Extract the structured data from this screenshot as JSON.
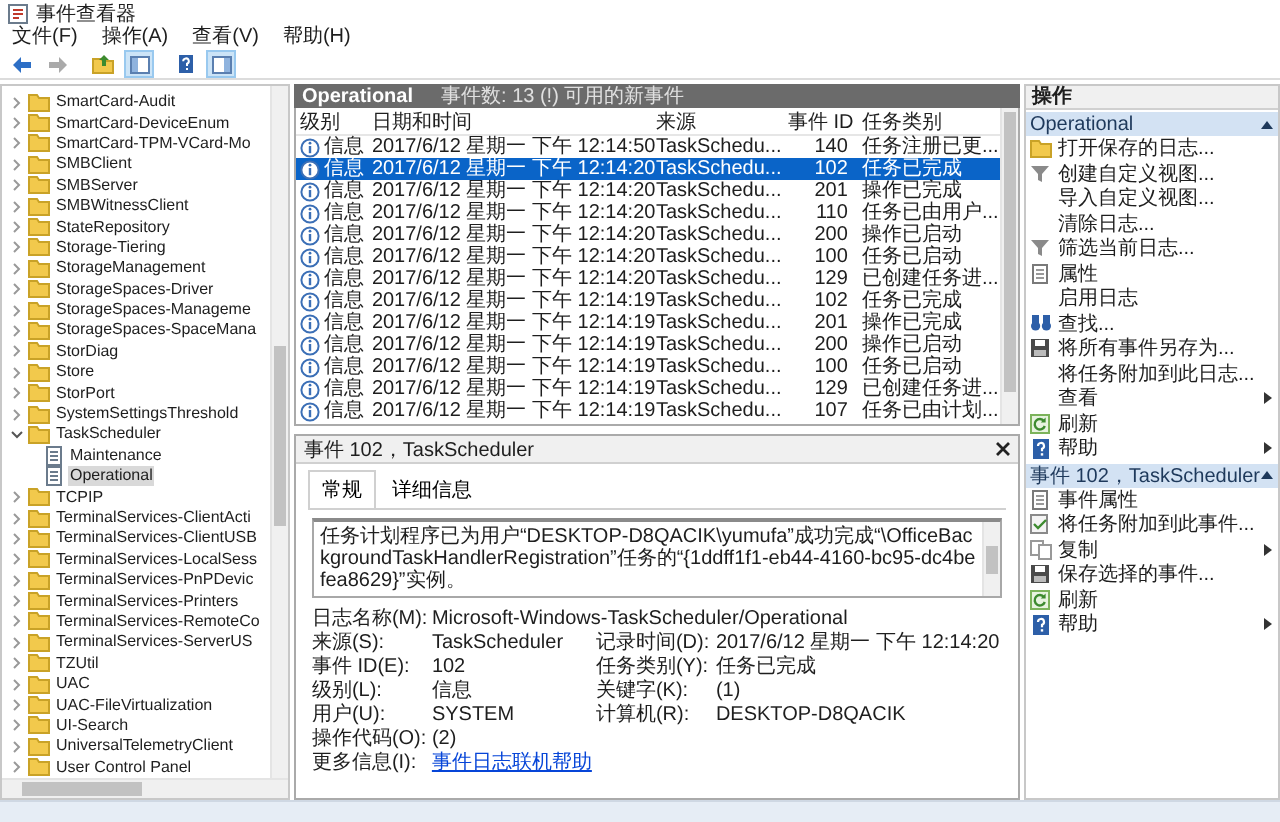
{
  "window": {
    "title": "事件查看器"
  },
  "menu": [
    "文件(F)",
    "操作(A)",
    "查看(V)",
    "帮助(H)"
  ],
  "toolbar": [
    {
      "kind": "back",
      "disabled": false,
      "pressed": false
    },
    {
      "kind": "forward",
      "disabled": true,
      "pressed": false
    },
    {
      "kind": "up",
      "pressed": false
    },
    {
      "kind": "tree",
      "pressed": true
    },
    {
      "kind": "help",
      "pressed": false
    },
    {
      "kind": "pane",
      "pressed": true
    }
  ],
  "tree": {
    "items": [
      {
        "label": "SmartCard-Audit",
        "kind": "folder",
        "expanded": false,
        "selected": false
      },
      {
        "label": "SmartCard-DeviceEnum",
        "kind": "folder",
        "expanded": false,
        "selected": false
      },
      {
        "label": "SmartCard-TPM-VCard-Mo",
        "kind": "folder",
        "expanded": false,
        "selected": false
      },
      {
        "label": "SMBClient",
        "kind": "folder",
        "expanded": false,
        "selected": false
      },
      {
        "label": "SMBServer",
        "kind": "folder",
        "expanded": false,
        "selected": false
      },
      {
        "label": "SMBWitnessClient",
        "kind": "folder",
        "expanded": false,
        "selected": false
      },
      {
        "label": "StateRepository",
        "kind": "folder",
        "expanded": false,
        "selected": false
      },
      {
        "label": "Storage-Tiering",
        "kind": "folder",
        "expanded": false,
        "selected": false
      },
      {
        "label": "StorageManagement",
        "kind": "folder",
        "expanded": false,
        "selected": false
      },
      {
        "label": "StorageSpaces-Driver",
        "kind": "folder",
        "expanded": false,
        "selected": false
      },
      {
        "label": "StorageSpaces-Manageme",
        "kind": "folder",
        "expanded": false,
        "selected": false
      },
      {
        "label": "StorageSpaces-SpaceMana",
        "kind": "folder",
        "expanded": false,
        "selected": false
      },
      {
        "label": "StorDiag",
        "kind": "folder",
        "expanded": false,
        "selected": false
      },
      {
        "label": "Store",
        "kind": "folder",
        "expanded": false,
        "selected": false
      },
      {
        "label": "StorPort",
        "kind": "folder",
        "expanded": false,
        "selected": false
      },
      {
        "label": "SystemSettingsThreshold",
        "kind": "folder",
        "expanded": false,
        "selected": false
      },
      {
        "label": "TaskScheduler",
        "kind": "folder",
        "expanded": true,
        "selected": false,
        "children": [
          {
            "label": "Maintenance",
            "kind": "log",
            "selected": false
          },
          {
            "label": "Operational",
            "kind": "log",
            "selected": true
          }
        ]
      },
      {
        "label": "TCPIP",
        "kind": "folder",
        "expanded": false,
        "selected": false
      },
      {
        "label": "TerminalServices-ClientActi",
        "kind": "folder",
        "expanded": false,
        "selected": false
      },
      {
        "label": "TerminalServices-ClientUSB",
        "kind": "folder",
        "expanded": false,
        "selected": false
      },
      {
        "label": "TerminalServices-LocalSess",
        "kind": "folder",
        "expanded": false,
        "selected": false
      },
      {
        "label": "TerminalServices-PnPDevic",
        "kind": "folder",
        "expanded": false,
        "selected": false
      },
      {
        "label": "TerminalServices-Printers",
        "kind": "folder",
        "expanded": false,
        "selected": false
      },
      {
        "label": "TerminalServices-RemoteCo",
        "kind": "folder",
        "expanded": false,
        "selected": false
      },
      {
        "label": "TerminalServices-ServerUS",
        "kind": "folder",
        "expanded": false,
        "selected": false
      },
      {
        "label": "TZUtil",
        "kind": "folder",
        "expanded": false,
        "selected": false
      },
      {
        "label": "UAC",
        "kind": "folder",
        "expanded": false,
        "selected": false
      },
      {
        "label": "UAC-FileVirtualization",
        "kind": "folder",
        "expanded": false,
        "selected": false
      },
      {
        "label": "UI-Search",
        "kind": "folder",
        "expanded": false,
        "selected": false
      },
      {
        "label": "UniversalTelemetryClient",
        "kind": "folder",
        "expanded": false,
        "selected": false
      },
      {
        "label": "User Control Panel",
        "kind": "folder",
        "expanded": false,
        "selected": false
      }
    ]
  },
  "log_header": {
    "title": "Operational",
    "summary": "事件数: 13 (!) 可用的新事件"
  },
  "table": {
    "columns": [
      "级别",
      "日期和时间",
      "来源",
      "事件 ID",
      "任务类别"
    ],
    "rows": [
      {
        "kind": "info",
        "level": "信息",
        "date": "2017/6/12 星期一 下午 12:14:50",
        "source": "TaskSchedu...",
        "id": "140",
        "category": "任务注册已更...",
        "selected": false
      },
      {
        "kind": "info",
        "level": "信息",
        "date": "2017/6/12 星期一 下午 12:14:20",
        "source": "TaskSchedu...",
        "id": "102",
        "category": "任务已完成",
        "selected": true
      },
      {
        "kind": "info",
        "level": "信息",
        "date": "2017/6/12 星期一 下午 12:14:20",
        "source": "TaskSchedu...",
        "id": "201",
        "category": "操作已完成",
        "selected": false
      },
      {
        "kind": "info",
        "level": "信息",
        "date": "2017/6/12 星期一 下午 12:14:20",
        "source": "TaskSchedu...",
        "id": "110",
        "category": "任务已由用户...",
        "selected": false
      },
      {
        "kind": "info",
        "level": "信息",
        "date": "2017/6/12 星期一 下午 12:14:20",
        "source": "TaskSchedu...",
        "id": "200",
        "category": "操作已启动",
        "selected": false
      },
      {
        "kind": "info",
        "level": "信息",
        "date": "2017/6/12 星期一 下午 12:14:20",
        "source": "TaskSchedu...",
        "id": "100",
        "category": "任务已启动",
        "selected": false
      },
      {
        "kind": "info",
        "level": "信息",
        "date": "2017/6/12 星期一 下午 12:14:20",
        "source": "TaskSchedu...",
        "id": "129",
        "category": "已创建任务进...",
        "selected": false
      },
      {
        "kind": "info",
        "level": "信息",
        "date": "2017/6/12 星期一 下午 12:14:19",
        "source": "TaskSchedu...",
        "id": "102",
        "category": "任务已完成",
        "selected": false
      },
      {
        "kind": "info",
        "level": "信息",
        "date": "2017/6/12 星期一 下午 12:14:19",
        "source": "TaskSchedu...",
        "id": "201",
        "category": "操作已完成",
        "selected": false
      },
      {
        "kind": "info",
        "level": "信息",
        "date": "2017/6/12 星期一 下午 12:14:19",
        "source": "TaskSchedu...",
        "id": "200",
        "category": "操作已启动",
        "selected": false
      },
      {
        "kind": "info",
        "level": "信息",
        "date": "2017/6/12 星期一 下午 12:14:19",
        "source": "TaskSchedu...",
        "id": "100",
        "category": "任务已启动",
        "selected": false
      },
      {
        "kind": "info",
        "level": "信息",
        "date": "2017/6/12 星期一 下午 12:14:19",
        "source": "TaskSchedu...",
        "id": "129",
        "category": "已创建任务进...",
        "selected": false
      },
      {
        "kind": "info",
        "level": "信息",
        "date": "2017/6/12 星期一 下午 12:14:19",
        "source": "TaskSchedu...",
        "id": "107",
        "category": "任务已由计划...",
        "selected": false
      }
    ]
  },
  "detail": {
    "title": "事件 102，TaskScheduler",
    "tabs": [
      {
        "label": "常规",
        "selected": true
      },
      {
        "label": "详细信息",
        "selected": false
      }
    ],
    "description": "任务计划程序已为用户“DESKTOP-D8QACIK\\yumufa”成功完成“\\OfficeBackgroundTaskHandlerRegistration”任务的“{1ddff1f1-eb44-4160-bc95-dc4befea8629}”实例。",
    "fields": [
      [
        {
          "label": "日志名称(M):",
          "value": "Microsoft-Windows-TaskScheduler/Operational",
          "kind": "text"
        }
      ],
      [
        {
          "label": "来源(S):",
          "value": "TaskScheduler",
          "kind": "text"
        },
        {
          "label": "记录时间(D):",
          "value": "2017/6/12 星期一 下午 12:14:20",
          "kind": "text"
        }
      ],
      [
        {
          "label": "事件 ID(E):",
          "value": "102",
          "kind": "text"
        },
        {
          "label": "任务类别(Y):",
          "value": "任务已完成",
          "kind": "text"
        }
      ],
      [
        {
          "label": "级别(L):",
          "value": "信息",
          "kind": "text"
        },
        {
          "label": "关键字(K):",
          "value": "(1)",
          "kind": "text"
        }
      ],
      [
        {
          "label": "用户(U):",
          "value": "SYSTEM",
          "kind": "text"
        },
        {
          "label": "计算机(R):",
          "value": "DESKTOP-D8QACIK",
          "kind": "text"
        }
      ],
      [
        {
          "label": "操作代码(O):",
          "value": "(2)",
          "kind": "text"
        }
      ],
      [
        {
          "label": "更多信息(I):",
          "value": "事件日志联机帮助",
          "kind": "link"
        }
      ]
    ]
  },
  "actions": {
    "title": "操作",
    "sections": [
      {
        "title": "Operational",
        "expanded": true,
        "items": [
          {
            "label": "打开保存的日志...",
            "kind": "folder",
            "submenu": false
          },
          {
            "label": "创建自定义视图...",
            "kind": "funnel",
            "submenu": false
          },
          {
            "label": "导入自定义视图...",
            "kind": "plain",
            "submenu": false
          },
          {
            "label": "清除日志...",
            "kind": "plain",
            "submenu": false
          },
          {
            "label": "筛选当前日志...",
            "kind": "funnel",
            "submenu": false
          },
          {
            "label": "属性",
            "kind": "page",
            "submenu": false
          },
          {
            "label": "启用日志",
            "kind": "plain",
            "submenu": false
          },
          {
            "label": "查找...",
            "kind": "binoculars",
            "submenu": false
          },
          {
            "label": "将所有事件另存为...",
            "kind": "disk",
            "submenu": false
          },
          {
            "label": "将任务附加到此日志...",
            "kind": "plain",
            "submenu": false
          },
          {
            "label": "查看",
            "kind": "plain",
            "submenu": true
          },
          {
            "label": "刷新",
            "kind": "refresh",
            "submenu": false
          },
          {
            "label": "帮助",
            "kind": "help",
            "submenu": true
          }
        ]
      },
      {
        "title": "事件 102，TaskScheduler",
        "expanded": true,
        "items": [
          {
            "label": "事件属性",
            "kind": "page",
            "submenu": false
          },
          {
            "label": "将任务附加到此事件...",
            "kind": "task",
            "submenu": false
          },
          {
            "label": "复制",
            "kind": "copy",
            "submenu": true
          },
          {
            "label": "保存选择的事件...",
            "kind": "disk",
            "submenu": false
          },
          {
            "label": "刷新",
            "kind": "refresh",
            "submenu": false
          },
          {
            "label": "帮助",
            "kind": "help",
            "submenu": true
          }
        ]
      }
    ]
  }
}
